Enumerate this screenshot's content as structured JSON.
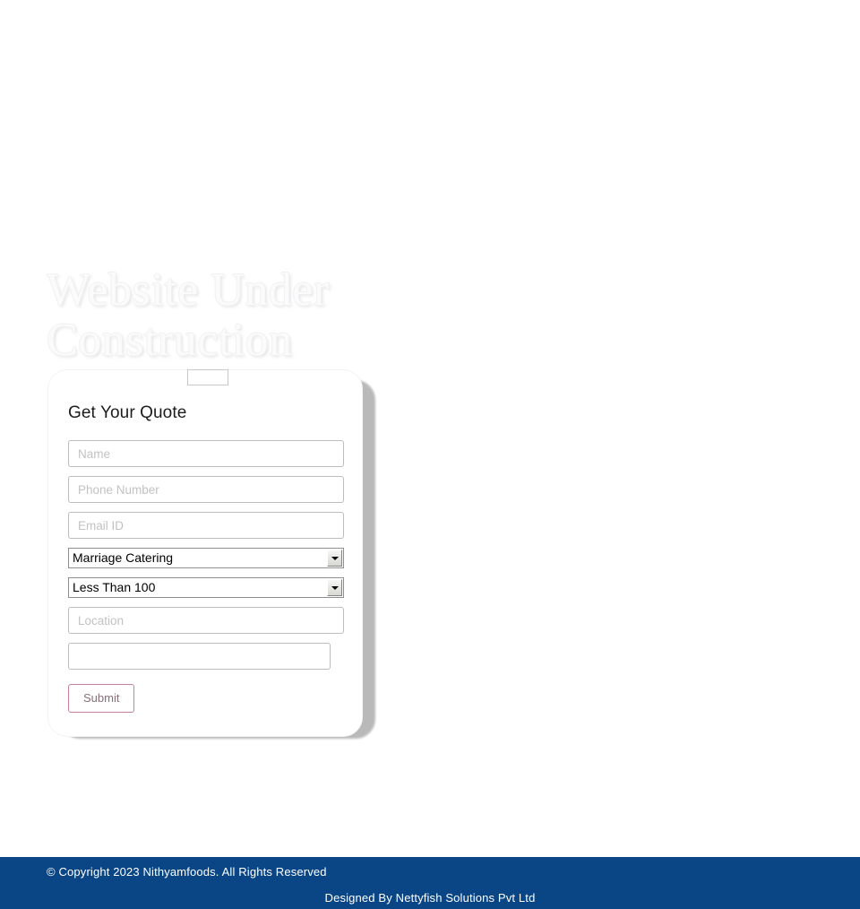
{
  "hero": {
    "title": "Website Under\nConstruction"
  },
  "card": {
    "logo_alt": "",
    "title": "Get Your Quote",
    "fields": [
      {
        "name": "name",
        "type": "text",
        "value": "",
        "placeholder": "Name"
      },
      {
        "name": "phone_number",
        "type": "text",
        "value": "",
        "placeholder": "Phone Number"
      },
      {
        "name": "email_id",
        "type": "text",
        "value": "",
        "placeholder": "Email ID"
      },
      {
        "name": "location",
        "type": "text",
        "value": "",
        "placeholder": "Location"
      },
      {
        "name": "message",
        "type": "text",
        "value": "",
        "placeholder": ""
      }
    ],
    "event_type_select": {
      "selected": "Marriage Catering",
      "options": [
        "Marriage Catering"
      ]
    },
    "guest_count_select": {
      "selected": "Less Than 100",
      "options": [
        "Less Than 100"
      ]
    },
    "submit_label": "Submit"
  },
  "footer": {
    "copyright": "© Copyright 2023 Nithyamfoods. All Rights Reserved",
    "credit": "Designed By Nettyfish Solutions Pvt Ltd",
    "background_color": "#0a4686",
    "text_color": "#ffffff"
  },
  "colors": {
    "page_background": "#ffffff",
    "hero_text": "#fbfbfc",
    "card_background": "#ffffff",
    "card_shadow": "#b0b0b0",
    "input_border": "#bdbdbd",
    "placeholder": "#c2c2c2",
    "submit_border": "#c87f9c",
    "submit_text": "#8a6f78",
    "footer_blue": "#0a4686"
  }
}
